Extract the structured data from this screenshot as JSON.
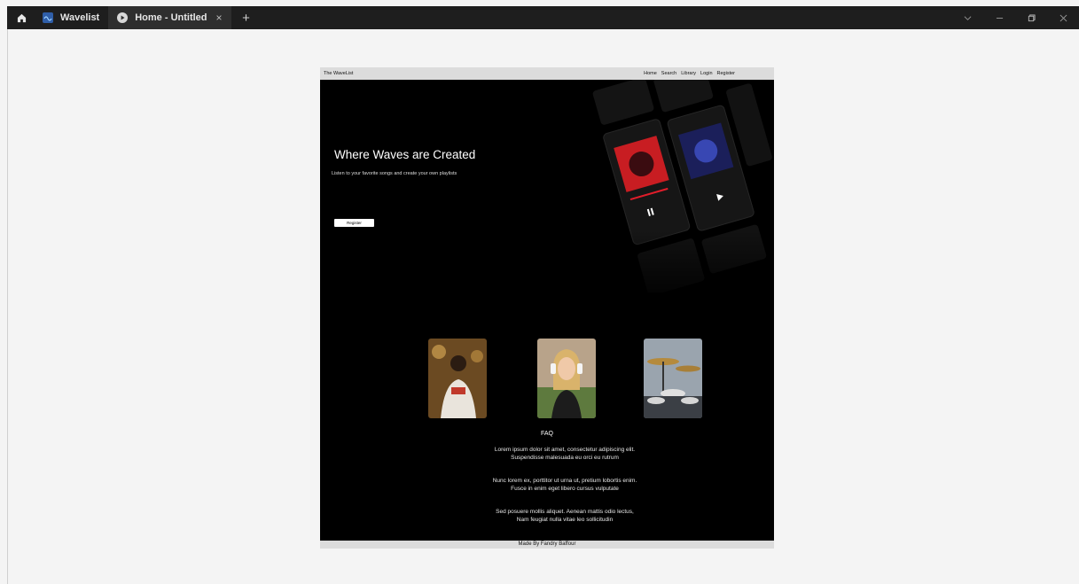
{
  "window": {
    "tabs": [
      {
        "label": "Wavelist"
      },
      {
        "label": "Home - Untitled",
        "close": "×"
      }
    ],
    "new_tab": "+"
  },
  "page": {
    "navbar": {
      "brand": "The WaveList",
      "links": [
        "Home",
        "Search",
        "Library",
        "Login",
        "Register"
      ]
    },
    "hero": {
      "title": "Where Waves are Created",
      "subtitle": "Listen to your favorite songs and create your own playlists",
      "button": "Register"
    },
    "faq": {
      "title": "FAQ",
      "items": [
        [
          "Lorem ipsum dolor sit amet, consectetur adipiscing elit.",
          "Suspendisse malesuada eu orci eu rutrum"
        ],
        [
          "Nunc lorem ex, porttitor ut urna ut, pretium lobortis enim.",
          "Fusce in enim eget libero cursus vulputate"
        ],
        [
          "Sed posuere mollis aliquet. Aenean mattis odio lectus,",
          "Nam feugiat nulla vitae leo sollicitudin"
        ]
      ]
    },
    "footer": "Made By Fandry Baffour"
  },
  "colors": {
    "titlebar": "#1e1e1e",
    "accent_red": "#e11d2a",
    "page_bg": "#000000"
  }
}
